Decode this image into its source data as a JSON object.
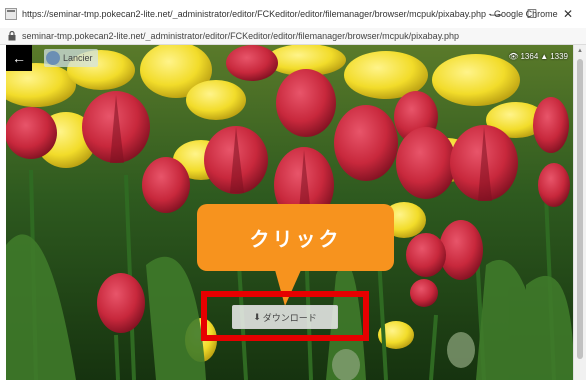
{
  "window": {
    "title": "https://seminar-tmp.pokecan2-lite.net/_administrator/editor/FCKeditor/editor/filemanager/browser/mcpuk/pixabay.php - Google Chrome",
    "minimize": "—",
    "maximize": "☐",
    "close": "✕"
  },
  "address": {
    "url": "seminar-tmp.pokecan2-lite.net/_administrator/editor/FCKeditor/editor/filemanager/browser/mcpuk/pixabay.php"
  },
  "viewer": {
    "back_glyph": "←",
    "author": "Lancier",
    "views": "1364",
    "downloads": "1339",
    "stat_view_glyph": "👁",
    "stat_download_glyph": "▲"
  },
  "callout": {
    "text": "クリック",
    "color": "#f7931e"
  },
  "download": {
    "label": "ダウンロード",
    "glyph": "⬇"
  },
  "highlight": {
    "color": "#e60000"
  }
}
